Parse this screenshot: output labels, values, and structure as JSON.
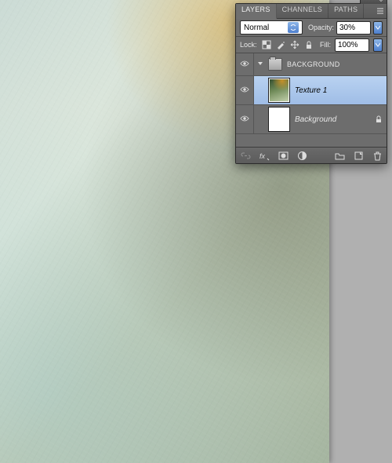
{
  "panel": {
    "tabs": {
      "layers": "LAYERS",
      "channels": "CHANNELS",
      "paths": "PATHS"
    },
    "blend_mode": "Normal",
    "opacity_label": "Opacity:",
    "opacity_value": "30%",
    "fill_label": "Fill:",
    "fill_value": "100%",
    "lock_label": "Lock:"
  },
  "layers": {
    "group_name": "BACKGROUND",
    "items": [
      {
        "name": "Texture 1",
        "selected": true,
        "locked": false,
        "kind": "texture"
      },
      {
        "name": "Background",
        "selected": false,
        "locked": true,
        "kind": "white"
      }
    ]
  }
}
